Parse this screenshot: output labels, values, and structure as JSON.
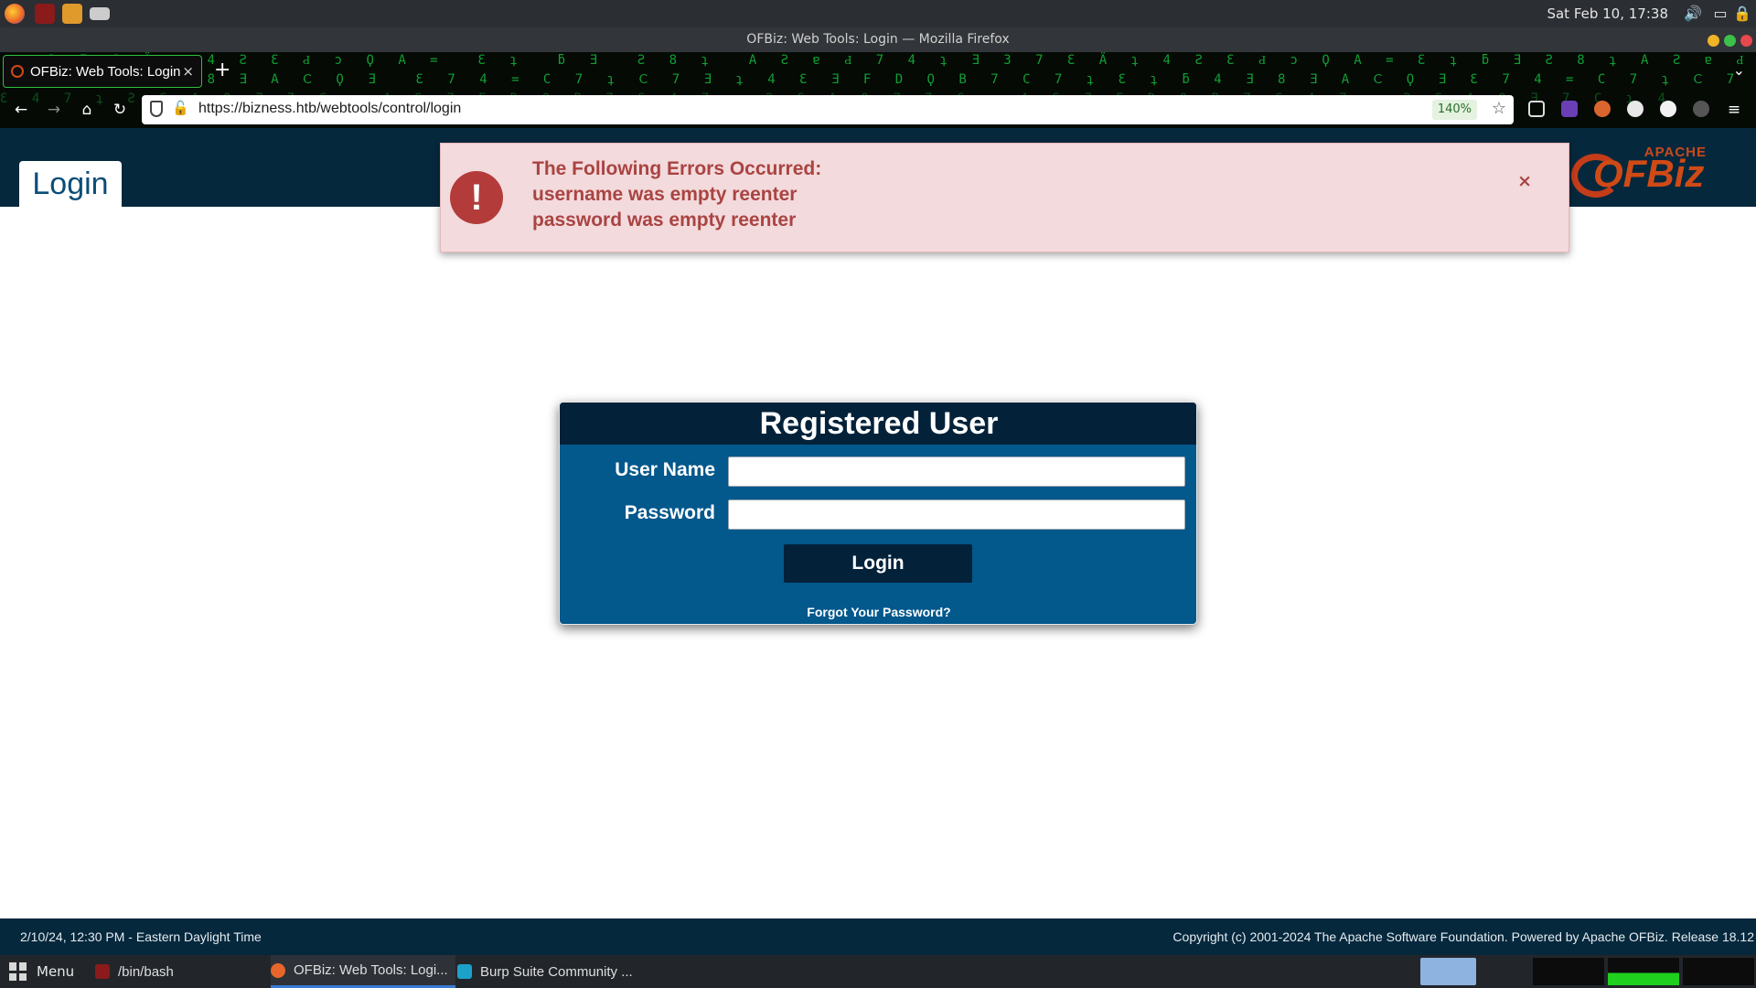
{
  "os": {
    "clock": "Sat Feb 10, 17:38"
  },
  "window": {
    "title": "OFBiz: Web Tools: Login — Mozilla Firefox"
  },
  "browser": {
    "tab_title": "OFBiz: Web Tools: Login",
    "tab_close": "×",
    "new_tab": "+",
    "url": "https://bizness.htb/webtools/control/login",
    "zoom": "140%"
  },
  "header": {
    "page_title": "Login",
    "logo_small": "APACHE",
    "logo_text": "OFBiz"
  },
  "error": {
    "icon": "!",
    "title": "The Following Errors Occurred:",
    "messages": [
      "username was empty reenter",
      "password was empty reenter"
    ],
    "close": "×"
  },
  "login": {
    "heading": "Registered User",
    "username_label": "User Name",
    "username_value": "",
    "password_label": "Password",
    "password_value": "",
    "button": "Login",
    "forgot": "Forgot Your Password?"
  },
  "footer": {
    "date": "2/10/24, 12:30 PM - Eastern Daylight Time",
    "copyright": "Copyright (c) 2001-2024 The Apache Software Foundation. Powered by Apache OFBiz. Release 18.12"
  },
  "taskbar": {
    "menu": "Menu",
    "tasks": [
      "/bin/bash",
      "OFBiz: Web Tools: Logi...",
      "Burp Suite Community ..."
    ]
  },
  "colors": {
    "header_bg": "#06283d",
    "panel_bg": "#03588c",
    "error_text": "#a94442",
    "error_bg": "#f3dadc"
  }
}
